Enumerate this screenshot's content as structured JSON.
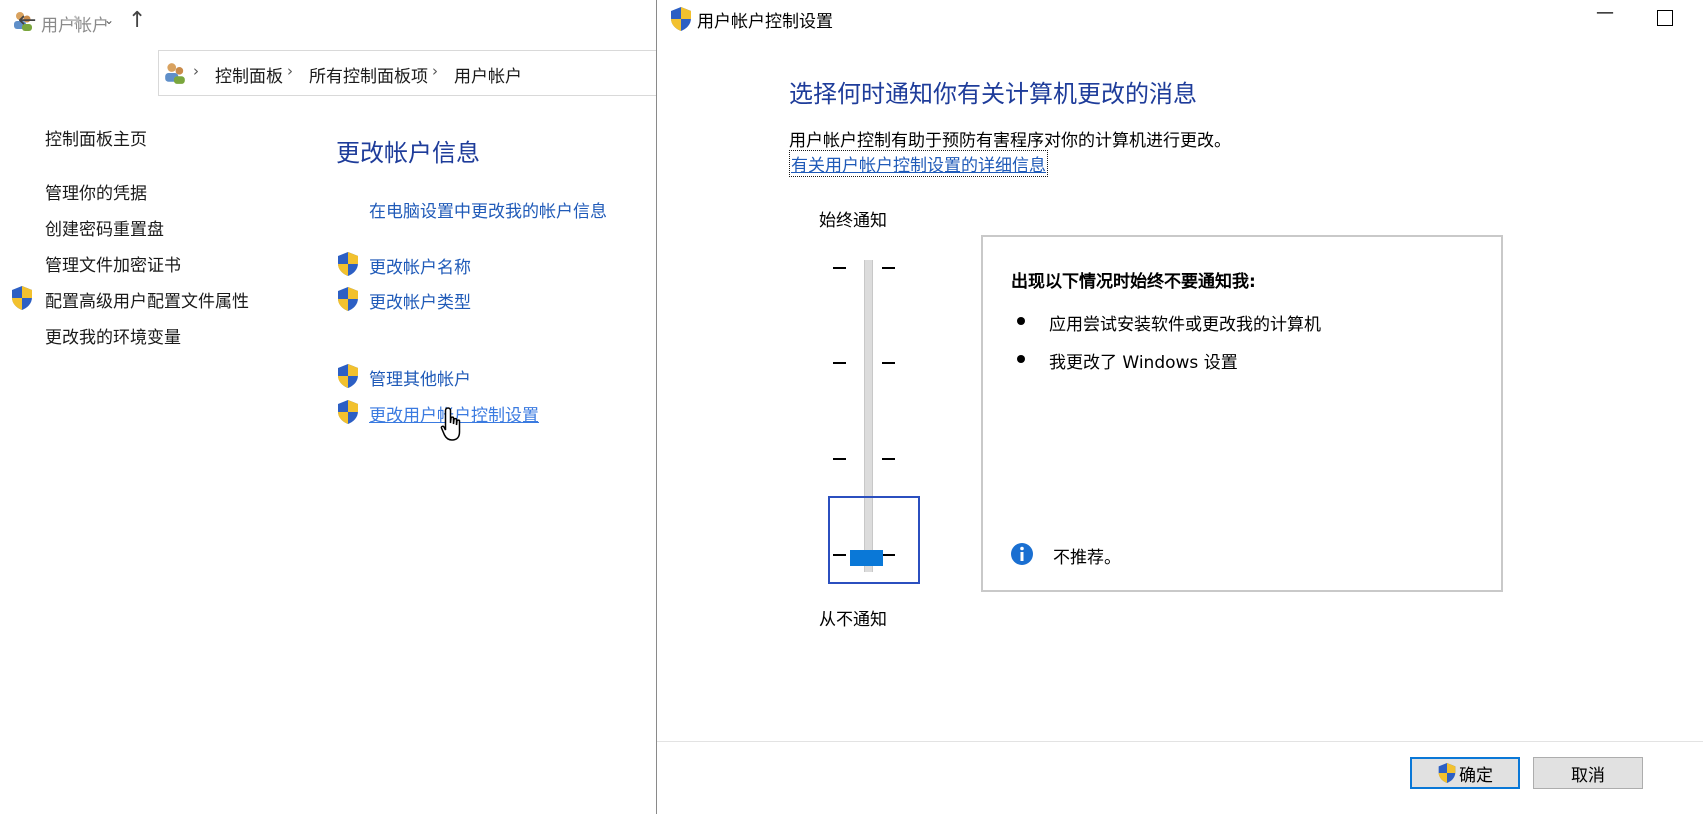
{
  "control_panel": {
    "title": "用户帐户",
    "breadcrumb": [
      "控制面板",
      "所有控制面板项",
      "用户帐户"
    ],
    "sidebar": [
      {
        "label": "控制面板主页",
        "shield": false
      },
      {
        "label": "管理你的凭据",
        "shield": false
      },
      {
        "label": "创建密码重置盘",
        "shield": false
      },
      {
        "label": "管理文件加密证书",
        "shield": false
      },
      {
        "label": "配置高级用户配置文件属性",
        "shield": true
      },
      {
        "label": "更改我的环境变量",
        "shield": false
      }
    ],
    "main_title": "更改帐户信息",
    "links": {
      "pc_settings": "在电脑设置中更改我的帐户信息",
      "change_name": "更改帐户名称",
      "change_type": "更改帐户类型",
      "manage_other": "管理其他帐户",
      "change_uac": "更改用户帐户控制设置"
    }
  },
  "uac_dialog": {
    "title": "用户帐户控制设置",
    "heading": "选择何时通知你有关计算机更改的消息",
    "description": "用户帐户控制有助于预防有害程序对你的计算机进行更改。",
    "more_info_link": "有关用户帐户控制设置的详细信息",
    "slider": {
      "top_label": "始终通知",
      "bottom_label": "从不通知",
      "levels": 4,
      "selected_level": 1
    },
    "info_box": {
      "title": "出现以下情况时始终不要通知我:",
      "bullets": [
        "应用尝试安装软件或更改我的计算机",
        "我更改了 Windows 设置"
      ],
      "note": "不推荐。"
    },
    "buttons": {
      "ok": "确定",
      "cancel": "取消"
    }
  },
  "colors": {
    "heading_blue": "#1e3c9a",
    "link_blue": "#1f5ab8",
    "slider_thumb": "#0a78d7"
  }
}
